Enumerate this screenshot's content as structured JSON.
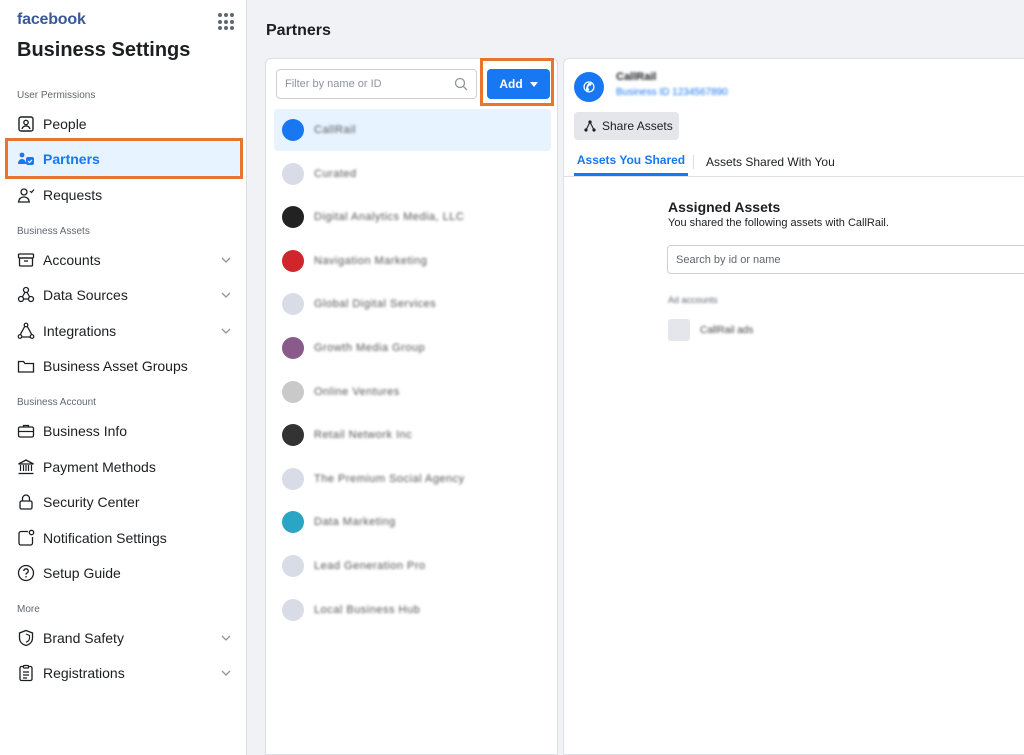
{
  "sidebar": {
    "brand": "facebook",
    "title": "Business Settings",
    "sections": {
      "user_permissions": "User Permissions",
      "business_assets": "Business Assets",
      "business_account": "Business Account",
      "more": "More"
    },
    "items": {
      "people": "People",
      "partners": "Partners",
      "requests": "Requests",
      "accounts": "Accounts",
      "data_sources": "Data Sources",
      "integrations": "Integrations",
      "business_asset_groups": "Business Asset Groups",
      "business_info": "Business Info",
      "payment_methods": "Payment Methods",
      "security_center": "Security Center",
      "notification_settings": "Notification Settings",
      "setup_guide": "Setup Guide",
      "brand_safety": "Brand Safety",
      "registrations": "Registrations"
    }
  },
  "main": {
    "page_title": "Partners",
    "filter_placeholder": "Filter by name or ID",
    "add_label": "Add",
    "partners": [
      {
        "name": "CallRail",
        "color": "#1877f2"
      },
      {
        "name": "Curated",
        "color": "#d8dce6"
      },
      {
        "name": "Digital Analytics Media, LLC",
        "color": "#222222"
      },
      {
        "name": "Navigation Marketing",
        "color": "#d0262b"
      },
      {
        "name": "Global Digital Services",
        "color": "#d8dce6"
      },
      {
        "name": "Growth Media Group",
        "color": "#8a5b8a"
      },
      {
        "name": "Online Ventures",
        "color": "#c9c9c9"
      },
      {
        "name": "Retail Network Inc",
        "color": "#333333"
      },
      {
        "name": "The Premium Social Agency",
        "color": "#d8dce6"
      },
      {
        "name": "Data Marketing",
        "color": "#2aa6c4"
      },
      {
        "name": "Lead Generation Pro",
        "color": "#d8dce6"
      },
      {
        "name": "Local Business Hub",
        "color": "#d8dce6"
      }
    ]
  },
  "detail": {
    "partner_name": "CallRail",
    "partner_id": "Business ID 1234567890",
    "share_label": "Share Assets",
    "tabs": [
      "Assets You Shared",
      "Assets Shared With You"
    ],
    "assigned_title": "Assigned Assets",
    "assigned_subtitle": "You shared the following assets with CallRail.",
    "search_placeholder": "Search by id or name",
    "asset_category": "Ad accounts",
    "asset_name": "CallRail ads"
  }
}
